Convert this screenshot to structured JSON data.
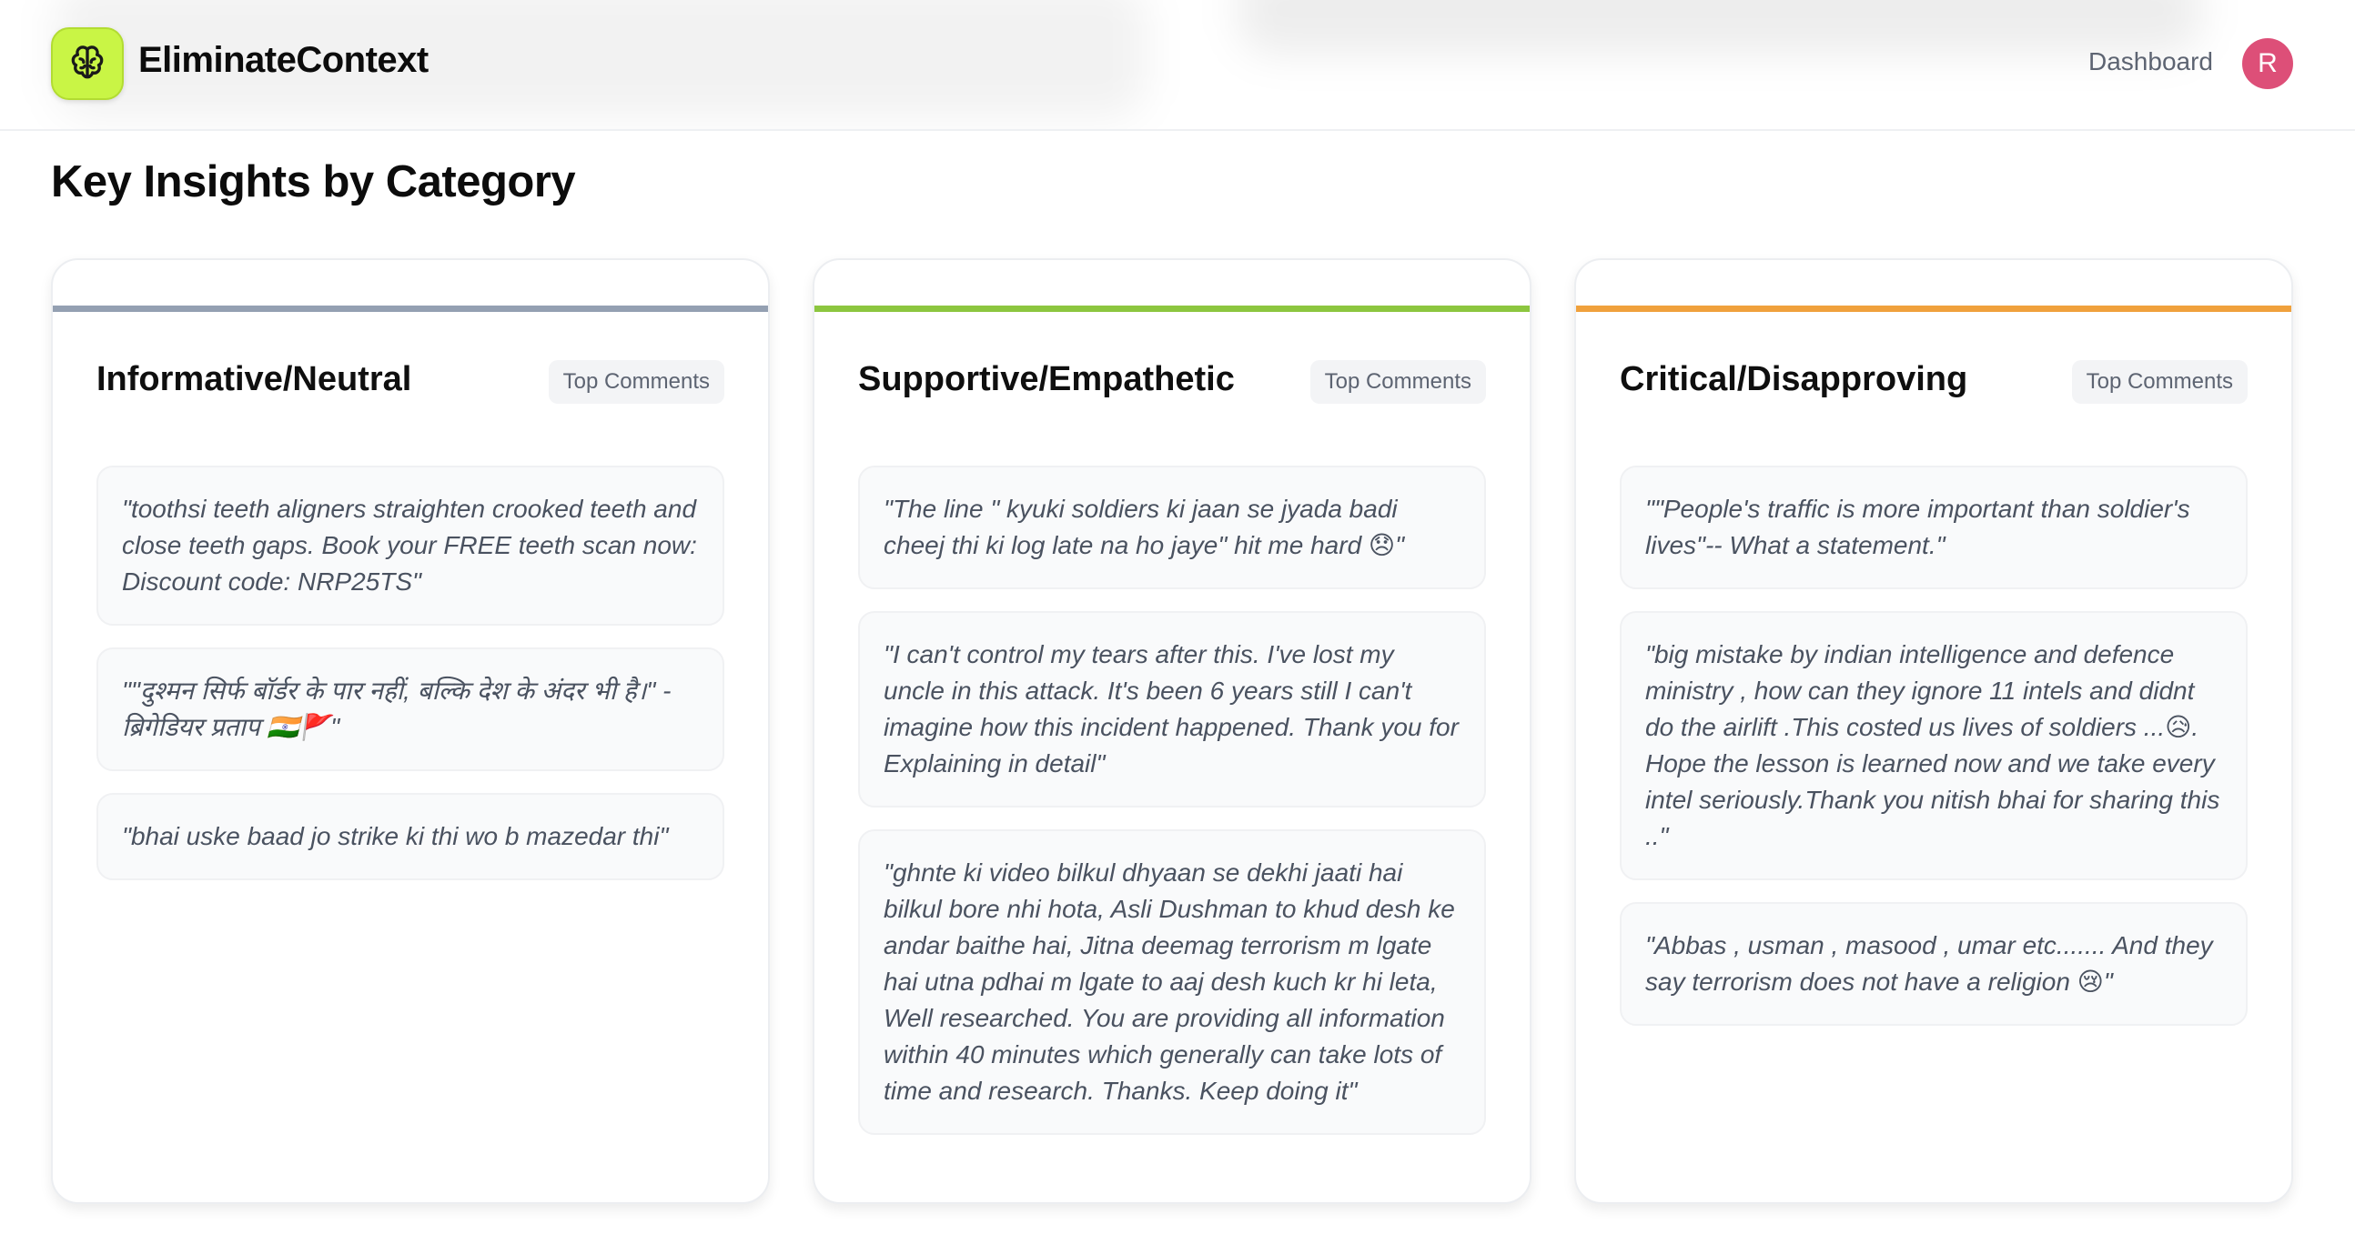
{
  "header": {
    "brand": "EliminateContext",
    "logo_icon": "brain-icon",
    "nav_dashboard": "Dashboard",
    "avatar_initial": "R"
  },
  "main": {
    "title": "Key Insights by Category",
    "categories": [
      {
        "title": "Informative/Neutral",
        "badge": "Top Comments",
        "accent_color": "#94a0b2",
        "comments": [
          "\"toothsi teeth aligners straighten crooked teeth and close teeth gaps. Book your FREE teeth scan now: Discount code: NRP25TS\"",
          "\"\"दुश्मन सिर्फ बॉर्डर के पार नहीं, बल्कि देश के अंदर भी है।\" - ब्रिगेडियर प्रताप 🇮🇳🚩\"",
          "\"bhai uske baad jo strike ki thi wo b mazedar thi\""
        ]
      },
      {
        "title": "Supportive/Empathetic",
        "badge": "Top Comments",
        "accent_color": "#8cc63f",
        "comments": [
          "\"The line \" kyuki soldiers ki jaan se jyada badi cheej thi ki log late na ho jaye\" hit me hard 😞\"",
          "\"I can't control my tears after this. I've lost my uncle in this attack. It's been 6 years still I can't imagine how this incident happened. Thank you for Explaining in detail\"",
          "\"ghnte ki video bilkul dhyaan se dekhi jaati hai bilkul bore nhi hota, Asli Dushman to khud desh ke andar baithe hai, Jitna deemag terrorism m lgate hai utna pdhai m lgate to aaj desh kuch kr hi leta, Well researched. You are providing all information within 40 minutes which generally can take lots of time and research. Thanks. Keep doing it\""
        ]
      },
      {
        "title": "Critical/Disapproving",
        "badge": "Top Comments",
        "accent_color": "#f0a13c",
        "comments": [
          "\"\"People's traffic is more important than soldier's lives\"-- What a statement.\"",
          "\"big mistake by indian intelligence and defence ministry , how can they ignore 11 intels and didnt do the airlift .This costed us lives of soldiers ...😥. Hope the lesson is learned now and we take every intel seriously.Thank you nitish bhai for sharing this ..\"",
          "\"Abbas , usman , masood , umar etc....... And they say terrorism does not have a religion 😢\""
        ]
      }
    ]
  }
}
